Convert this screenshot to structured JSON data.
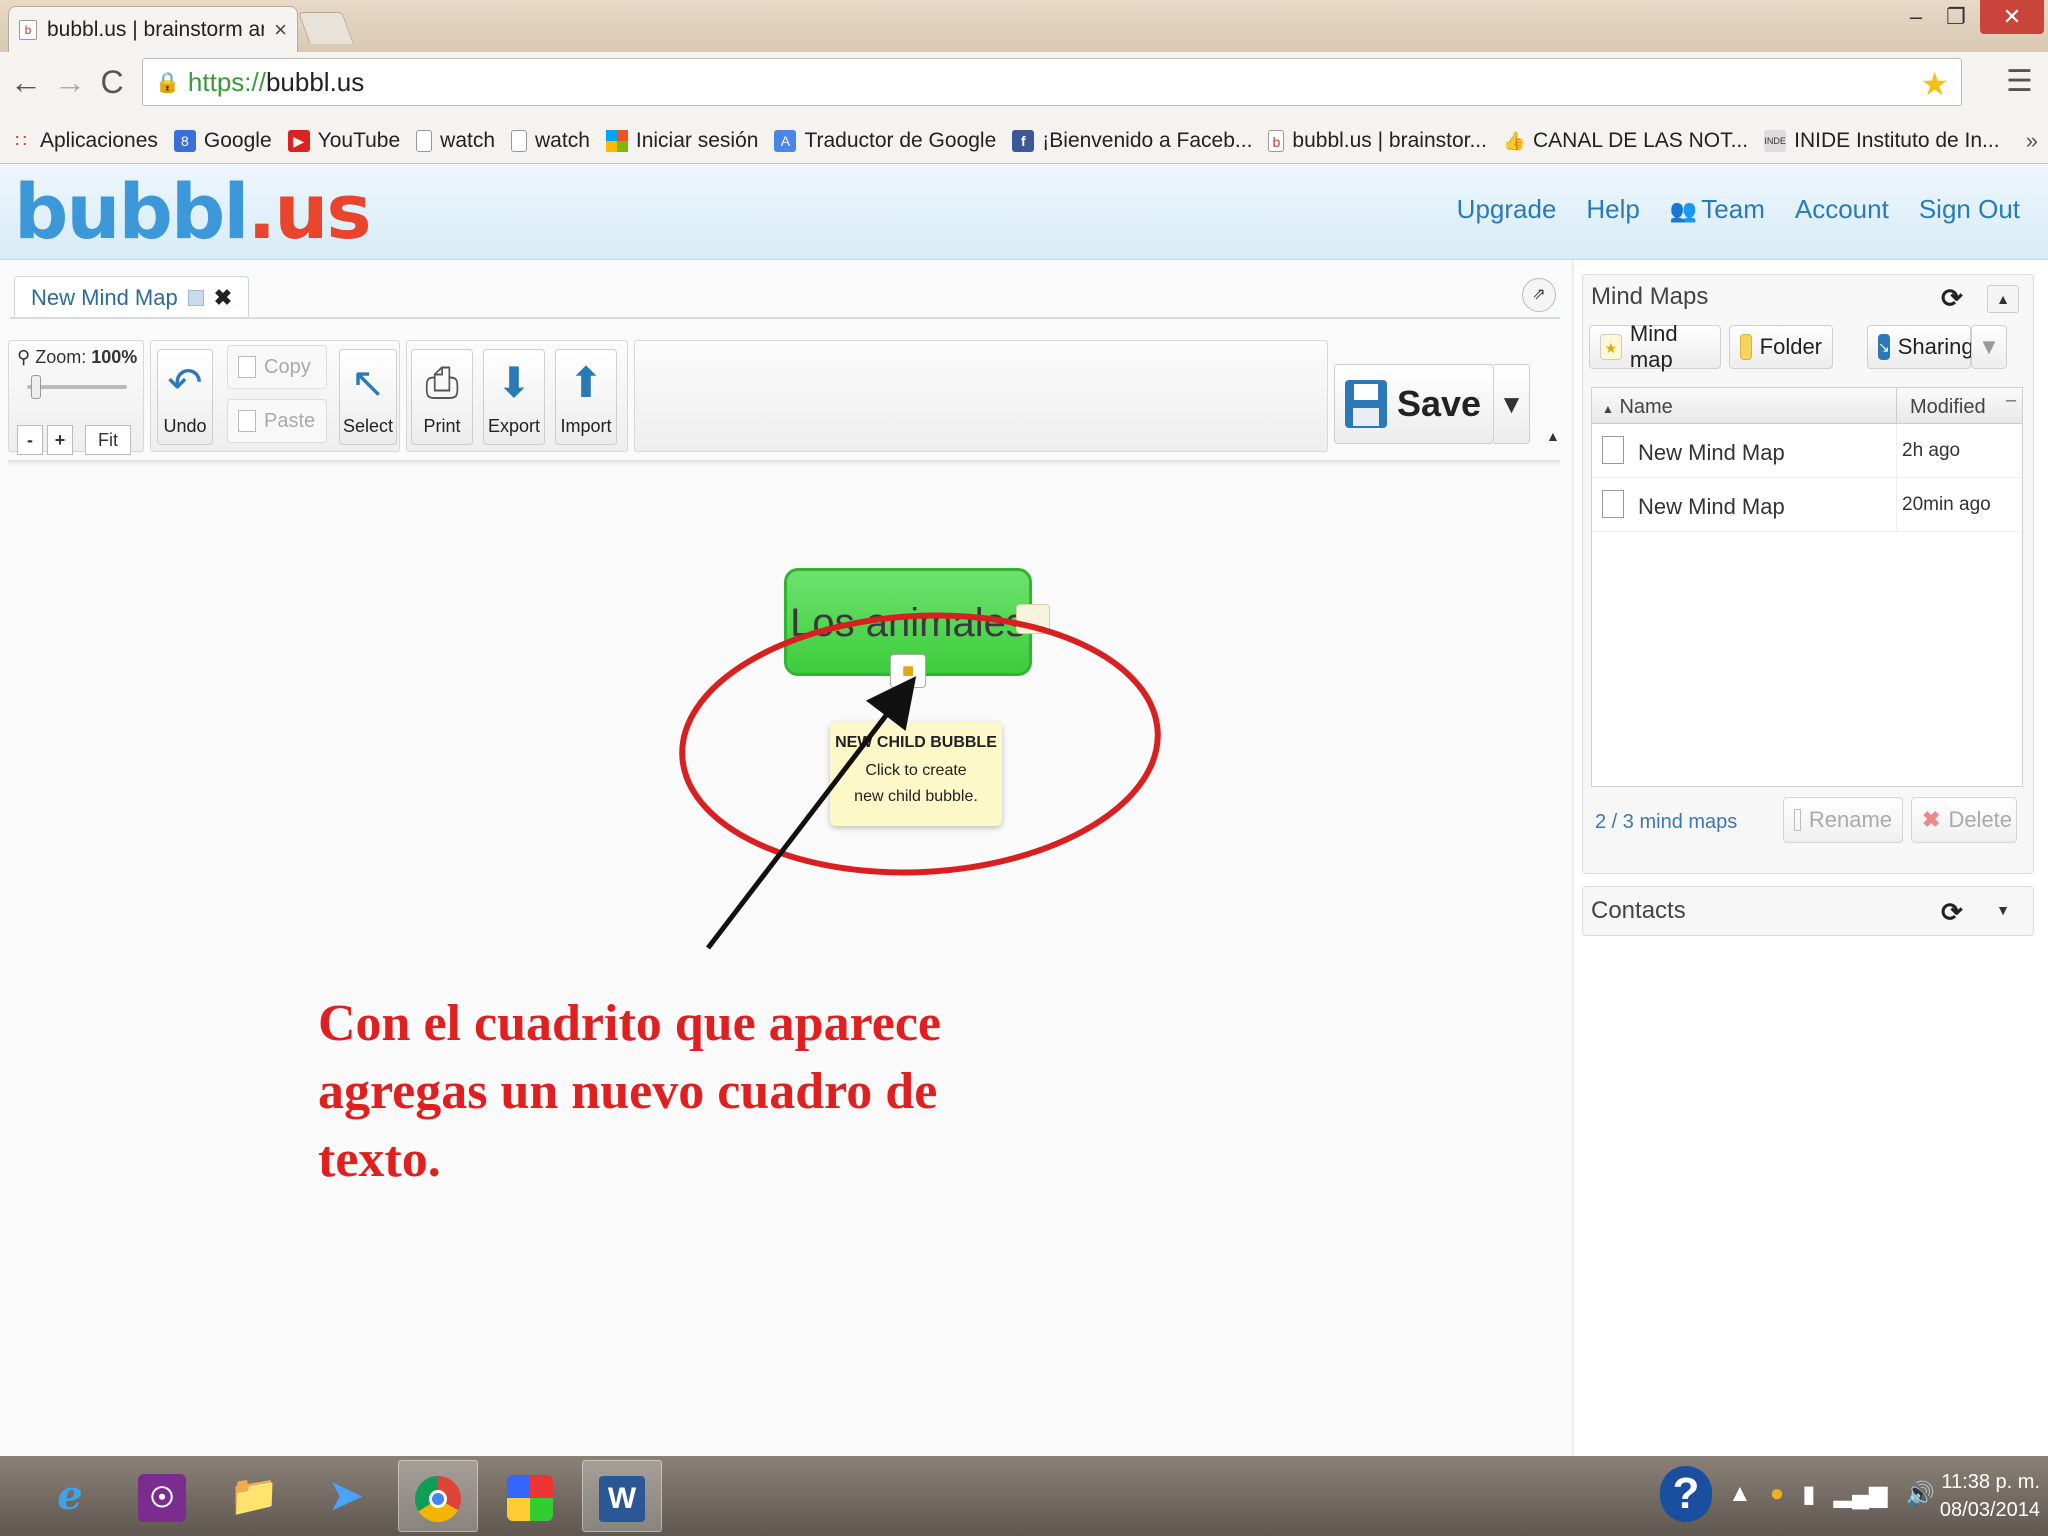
{
  "browser": {
    "tab_title": "bubbl.us | brainstorm and",
    "tab_close": "×",
    "url_scheme": "https://",
    "url_host": "bubbl.us",
    "window_min": "–",
    "window_max": "❐",
    "window_close": "✕",
    "nav_back": "←",
    "nav_forward": "→",
    "nav_reload": "C",
    "more_bookmarks": "»",
    "bookmarks": [
      {
        "label": "Aplicaciones",
        "icon": "apps-grid-icon"
      },
      {
        "label": "Google",
        "icon": "google-icon"
      },
      {
        "label": "YouTube",
        "icon": "youtube-icon"
      },
      {
        "label": "watch",
        "icon": "page-icon"
      },
      {
        "label": "watch",
        "icon": "page-icon"
      },
      {
        "label": "Iniciar sesión",
        "icon": "microsoft-icon"
      },
      {
        "label": "Traductor de Google",
        "icon": "translate-icon"
      },
      {
        "label": "¡Bienvenido a Faceb...",
        "icon": "facebook-icon"
      },
      {
        "label": "bubbl.us | brainstor...",
        "icon": "bubblus-icon"
      },
      {
        "label": "CANAL DE LAS NOT...",
        "icon": "like-icon"
      },
      {
        "label": "INIDE Instituto de In...",
        "icon": "inide-icon"
      }
    ]
  },
  "app": {
    "logo_bubbl": "bubbl",
    "logo_us": ".us",
    "nav": {
      "upgrade": "Upgrade",
      "help": "Help",
      "team": "Team",
      "account": "Account",
      "signout": "Sign Out"
    }
  },
  "editor": {
    "doc_tab": "New Mind Map",
    "zoom_label": "Zoom:",
    "zoom_value": "100%",
    "zoom_minus": "-",
    "zoom_plus": "+",
    "zoom_fit": "Fit",
    "toolbar": {
      "undo": "Undo",
      "copy": "Copy",
      "paste": "Paste",
      "select": "Select",
      "print": "Print",
      "export": "Export",
      "import": "Import",
      "save": "Save"
    },
    "root_bubble": "Los animales",
    "tooltip_title": "NEW CHILD BUBBLE",
    "tooltip_text": "Click to create new child bubble.",
    "annotation_text": "Con el cuadrito que aparece agregas un nuevo cuadro de texto.",
    "annotation_color": "#e02020"
  },
  "sidebar": {
    "mindmaps_title": "Mind Maps",
    "btn_mindmap": "Mind map",
    "btn_folder": "Folder",
    "btn_sharing": "Sharing",
    "col_name": "Name",
    "col_modified": "Modified",
    "maps": [
      {
        "name": "New Mind Map",
        "modified": "2h ago"
      },
      {
        "name": "New Mind Map",
        "modified": "20min ago"
      }
    ],
    "count": "2 / 3 mind maps",
    "btn_rename": "Rename",
    "btn_delete": "Delete",
    "contacts_title": "Contacts"
  },
  "taskbar": {
    "apps": [
      "internet-explorer-icon",
      "podcast-icon",
      "file-explorer-icon",
      "rocket-icon",
      "chrome-icon",
      "paint-icon",
      "word-icon"
    ],
    "time": "11:38 p. m.",
    "date": "08/03/2014"
  }
}
